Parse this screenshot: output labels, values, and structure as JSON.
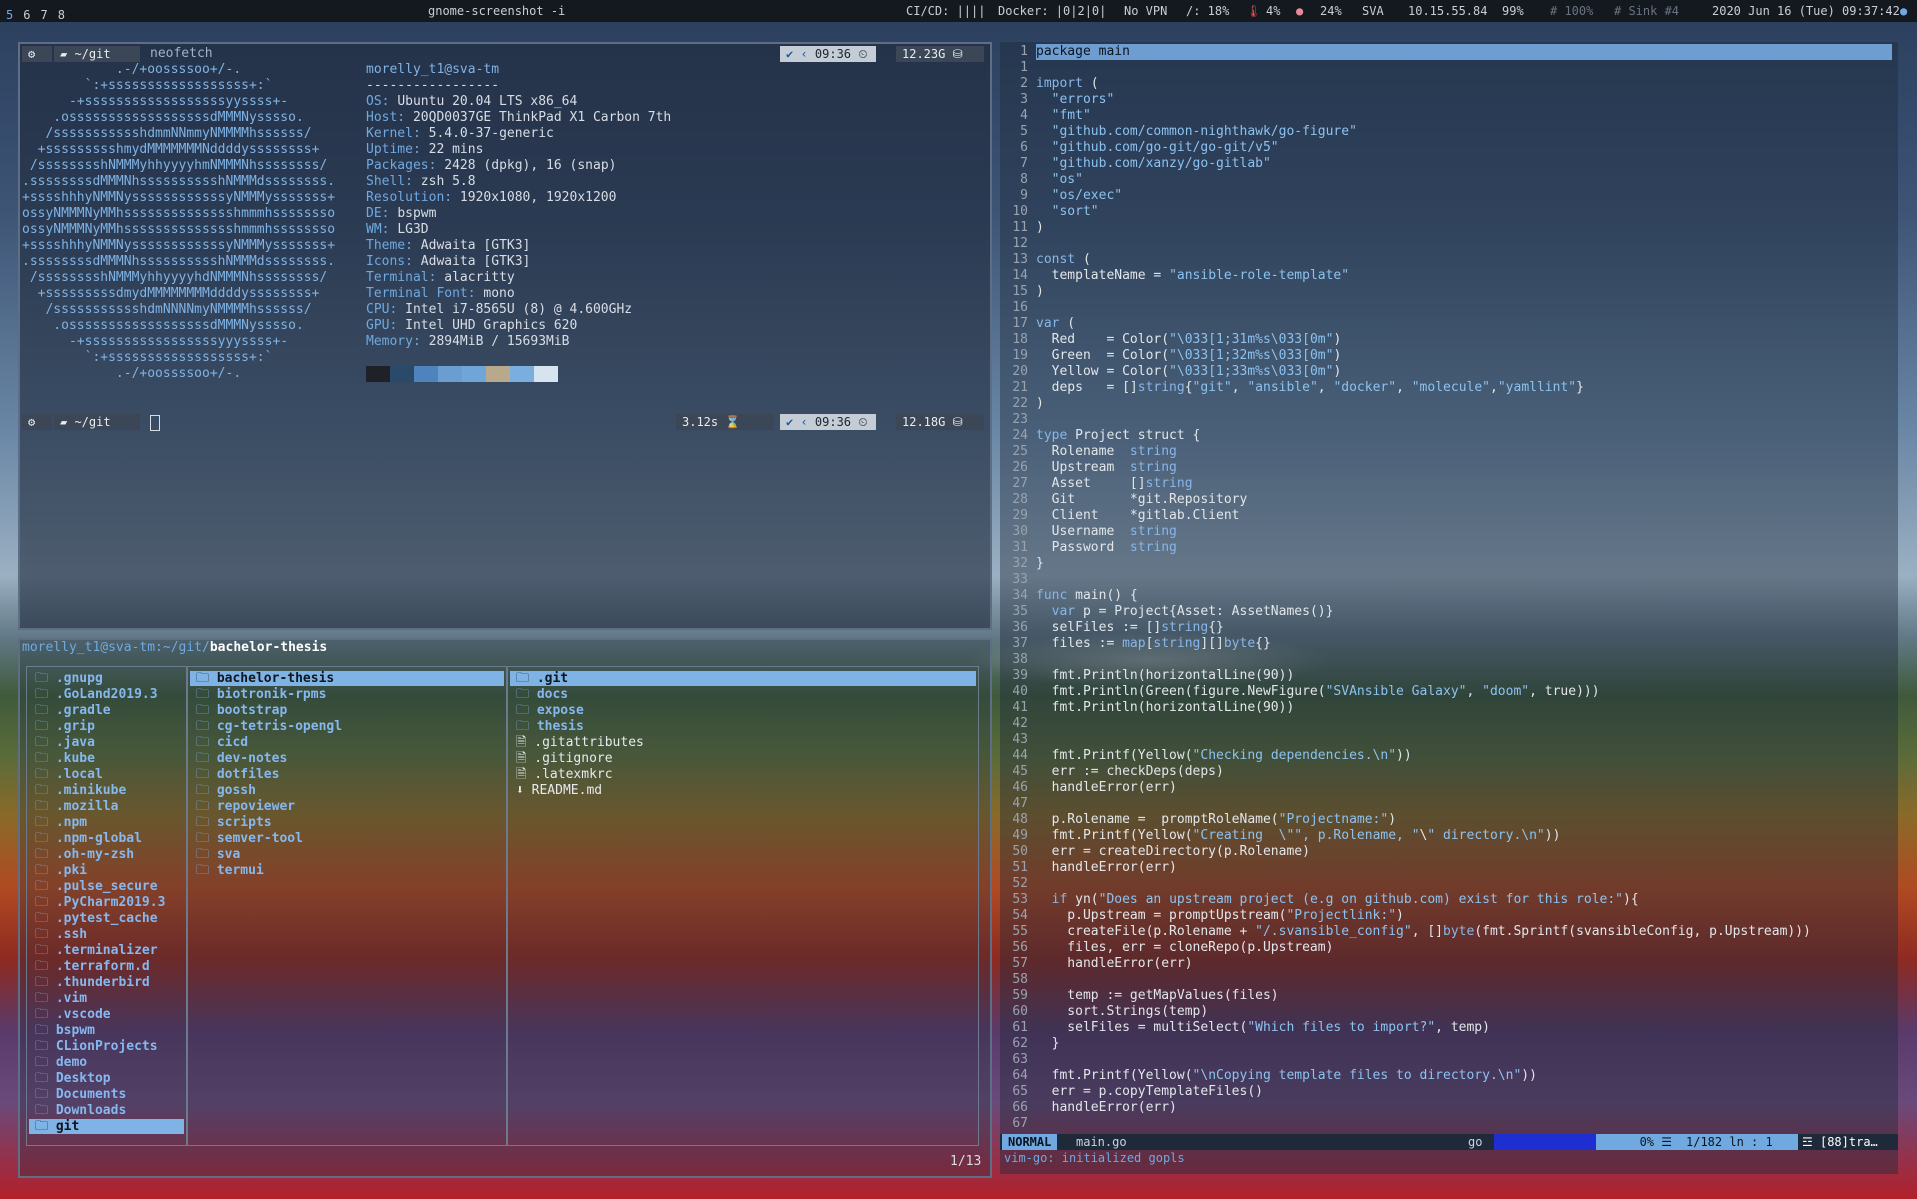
{
  "topbar": {
    "workspaces": [
      "5",
      "6",
      "7",
      "8"
    ],
    "title": "gnome-screenshot -i",
    "cicd": "CI/CD: ||||",
    "docker": "Docker: |0|2|0|",
    "vpn": "No VPN",
    "disk": "/: 18%",
    "temp": "4%",
    "mem": "24%",
    "net_name": "SVA",
    "ip": "10.15.55.84",
    "battery": "99%",
    "brightness": "# 100%",
    "sink": "# Sink #4",
    "datetime": "2020 Jun 16 (Tue) 09:37:42"
  },
  "neofetch": {
    "prompt_dir": "~/git",
    "command": "neofetch",
    "time": "09:36",
    "space": "12.23G",
    "user_host": "morelly_t1@sva-tm",
    "divider": "-----------------",
    "info": [
      {
        "k": "OS",
        "v": "Ubuntu 20.04 LTS x86_64"
      },
      {
        "k": "Host",
        "v": "20QD0037GE ThinkPad X1 Carbon 7th"
      },
      {
        "k": "Kernel",
        "v": "5.4.0-37-generic"
      },
      {
        "k": "Uptime",
        "v": "22 mins"
      },
      {
        "k": "Packages",
        "v": "2428 (dpkg), 16 (snap)"
      },
      {
        "k": "Shell",
        "v": "zsh 5.8"
      },
      {
        "k": "Resolution",
        "v": "1920x1080, 1920x1200"
      },
      {
        "k": "DE",
        "v": "bspwm"
      },
      {
        "k": "WM",
        "v": "LG3D"
      },
      {
        "k": "Theme",
        "v": "Adwaita [GTK3]"
      },
      {
        "k": "Icons",
        "v": "Adwaita [GTK3]"
      },
      {
        "k": "Terminal",
        "v": "alacritty"
      },
      {
        "k": "Terminal Font",
        "v": "mono"
      },
      {
        "k": "CPU",
        "v": "Intel i7-8565U (8) @ 4.600GHz"
      },
      {
        "k": "GPU",
        "v": "Intel UHD Graphics 620"
      },
      {
        "k": "Memory",
        "v": "2894MiB / 15693MiB"
      }
    ],
    "palette": [
      "#1e2228",
      "#2a4a6a",
      "#4d84bd",
      "#6a9ed0",
      "#6fa6d8",
      "#b8a98c",
      "#7aaede",
      "#d7e3ef"
    ],
    "logo": [
      "            .-/+oossssoo+/-.",
      "        `:+ssssssssssssssssss+:`",
      "      -+ssssssssssssssssssyyssss+-",
      "    .ossssssssssssssssssdMMMNysssso.",
      "   /ssssssssssshdmmNNmmyNMMMMhssssss/",
      "  +ssssssssshmydMMMMMMMNddddyssssssss+",
      " /sssssssshNMMMyhhyyyyhmNMMMNhssssssss/",
      ".ssssssssdMMMNhsssssssssshNMMMdssssssss.",
      "+sssshhhyNMMNyssssssssssssyNMMMysssssss+",
      "ossyNMMMNyMMhsssssssssssssshmmmhssssssso",
      "ossyNMMMNyMMhsssssssssssssshmmmhssssssso",
      "+sssshhhyNMMNyssssssssssssyNMMMysssssss+",
      ".ssssssssdMMMNhsssssssssshNMMMdssssssss.",
      " /sssssssshNMMMyhhyyyyhdNMMMNhssssssss/",
      "  +sssssssssdmydMMMMMMMMddddyssssssss+",
      "   /ssssssssssshdmNNNNmyNMMMMhssssss/",
      "    .ossssssssssssssssssdMMMNysssso.",
      "      -+sssssssssssssssssyyyssss+-",
      "        `:+ssssssssssssssssss+:`",
      "            .-/+oossssoo+/-."
    ],
    "prompt2_dir": "~/git",
    "elapsed": "3.12s",
    "time2": "09:36",
    "space2": "12.18G"
  },
  "ranger": {
    "path_prefix": "morelly_t1@sva-tm:~/git/",
    "path_current": "bachelor-thesis",
    "col1": [
      ".gnupg",
      ".GoLand2019.3",
      ".gradle",
      ".grip",
      ".java",
      ".kube",
      ".local",
      ".minikube",
      ".mozilla",
      ".npm",
      ".npm-global",
      ".oh-my-zsh",
      ".pki",
      ".pulse_secure",
      ".PyCharm2019.3",
      ".pytest_cache",
      ".ssh",
      ".terminalizer",
      ".terraform.d",
      ".thunderbird",
      ".vim",
      ".vscode",
      "bspwm",
      "CLionProjects",
      "demo",
      "Desktop",
      "Documents",
      "Downloads",
      "git"
    ],
    "col2": [
      "bachelor-thesis",
      "biotronik-rpms",
      "bootstrap",
      "cg-tetris-opengl",
      "cicd",
      "dev-notes",
      "dotfiles",
      "gossh",
      "repoviewer",
      "scripts",
      "semver-tool",
      "sva",
      "termui"
    ],
    "col3": [
      {
        "name": ".git",
        "dir": true
      },
      {
        "name": "docs",
        "dir": true
      },
      {
        "name": "expose",
        "dir": true
      },
      {
        "name": "thesis",
        "dir": true
      },
      {
        "name": ".gitattributes",
        "dir": false
      },
      {
        "name": ".gitignore",
        "dir": false
      },
      {
        "name": ".latexmkrc",
        "dir": false
      },
      {
        "name": "README.md",
        "dir": false
      }
    ],
    "counter": "1/13"
  },
  "editor": {
    "lines": [
      "package main",
      "",
      "import (",
      "\t\"errors\"",
      "\t\"fmt\"",
      "\t\"github.com/common-nighthawk/go-figure\"",
      "\t\"github.com/go-git/go-git/v5\"",
      "\t\"github.com/xanzy/go-gitlab\"",
      "\t\"os\"",
      "\t\"os/exec\"",
      "\t\"sort\"",
      ")",
      "",
      "const (",
      "\ttemplateName = \"ansible-role-template\"",
      ")",
      "",
      "var (",
      "\tRed    = Color(\"\\033[1;31m%s\\033[0m\")",
      "\tGreen  = Color(\"\\033[1;32m%s\\033[0m\")",
      "\tYellow = Color(\"\\033[1;33m%s\\033[0m\")",
      "\tdeps   = []string{\"git\", \"ansible\", \"docker\", \"molecule\",\"yamllint\"}",
      ")",
      "",
      "type Project struct {",
      "\tRolename  string",
      "\tUpstream  string",
      "\tAsset     []string",
      "\tGit       *git.Repository",
      "\tClient    *gitlab.Client",
      "\tUsername  string",
      "\tPassword  string",
      "}",
      "",
      "func main() {",
      "\tvar p = Project{Asset: AssetNames()}",
      "\tselFiles := []string{}",
      "\tfiles := map[string][]byte{}",
      "",
      "\tfmt.Println(horizontalLine(90))",
      "\tfmt.Println(Green(figure.NewFigure(\"SVAnsible Galaxy\", \"doom\", true)))",
      "\tfmt.Println(horizontalLine(90))",
      "",
      "",
      "\tfmt.Printf(Yellow(\"Checking dependencies.\\n\"))",
      "\terr := checkDeps(deps)",
      "\thandleError(err)",
      "",
      "\tp.Rolename =  promptRoleName(\"Projectname:\")",
      "\tfmt.Printf(Yellow(\"Creating  \\\"\", p.Rolename, \"\\\" directory.\\n\"))",
      "\terr = createDirectory(p.Rolename)",
      "\thandleError(err)",
      "",
      "\tif yn(\"Does an upstream project (e.g on github.com) exist for this role:\"){",
      "\t\tp.Upstream = promptUpstream(\"Projectlink:\")",
      "\t\tcreateFile(p.Rolename + \"/.svansible_config\", []byte(fmt.Sprintf(svansibleConfig, p.Upstream)))",
      "\t\tfiles, err = cloneRepo(p.Upstream)",
      "\t\thandleError(err)",
      "",
      "\t\ttemp := getMapValues(files)",
      "\t\tsort.Strings(temp)",
      "\t\tselFiles = multiSelect(\"Which files to import?\", temp)",
      "\t}",
      "",
      "\tfmt.Printf(Yellow(\"\\nCopying template files to directory.\\n\"))",
      "\terr = p.copyTemplateFiles()",
      "\thandleError(err)",
      ""
    ],
    "first_line_abs": "1",
    "mode": "NORMAL",
    "filename": "main.go",
    "filetype": "go",
    "percent": "0%",
    "position": "1/182",
    "ln_label": "ln :",
    "col": "1",
    "trail": "☲ [88]tra…",
    "message": "vim-go: initialized gopls"
  }
}
